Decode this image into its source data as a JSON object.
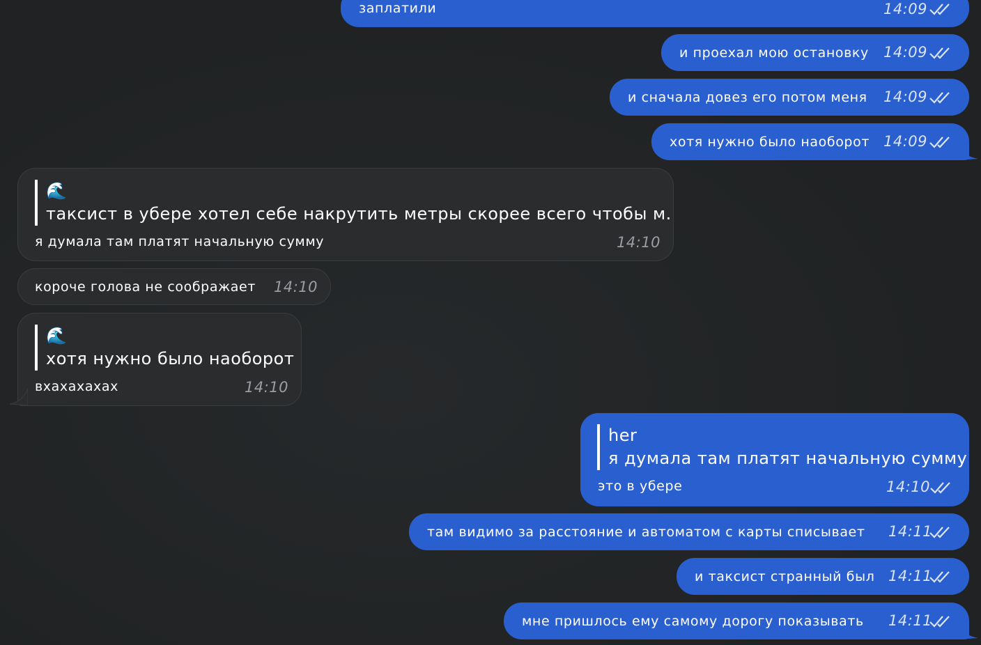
{
  "messages": [
    {
      "text": "заплатили",
      "time": "14:09",
      "dir": "out"
    },
    {
      "text": "и проехал мою остановку",
      "time": "14:09",
      "dir": "out"
    },
    {
      "text": "и сначала довез его потом меня",
      "time": "14:09",
      "dir": "out"
    },
    {
      "text": "хотя нужно было наоборот",
      "time": "14:09",
      "dir": "out"
    },
    {
      "reply_author": "🌊",
      "reply_text": "таксист в убере хотел себе накрутить метры скорее всего чтобы м...",
      "text": "я думала там платят начальную сумму",
      "time": "14:10",
      "dir": "in"
    },
    {
      "text": "короче голова не соображает",
      "time": "14:10",
      "dir": "in"
    },
    {
      "reply_author": "🌊",
      "reply_text": "хотя нужно было наоборот",
      "text": "вхахахахах",
      "time": "14:10",
      "dir": "in"
    },
    {
      "reply_author": "her",
      "reply_text": "я думала там платят начальную сумму",
      "text": "это в убере",
      "time": "14:10",
      "dir": "out"
    },
    {
      "text": "там видимо за расстояние и автоматом с карты списывает",
      "time": "14:11",
      "dir": "out"
    },
    {
      "text": "и таксист странный был",
      "time": "14:11",
      "dir": "out"
    },
    {
      "text": "мне пришлось ему самому дорогу показывать",
      "time": "14:11",
      "dir": "out"
    }
  ],
  "colors": {
    "background": "#222426",
    "outgoing_bubble": "#2a5fd0",
    "incoming_bubble": "#2b2c2e"
  },
  "icons": {
    "read_receipt": "double-check-icon",
    "reply_avatar": "wave-emoji-icon"
  }
}
